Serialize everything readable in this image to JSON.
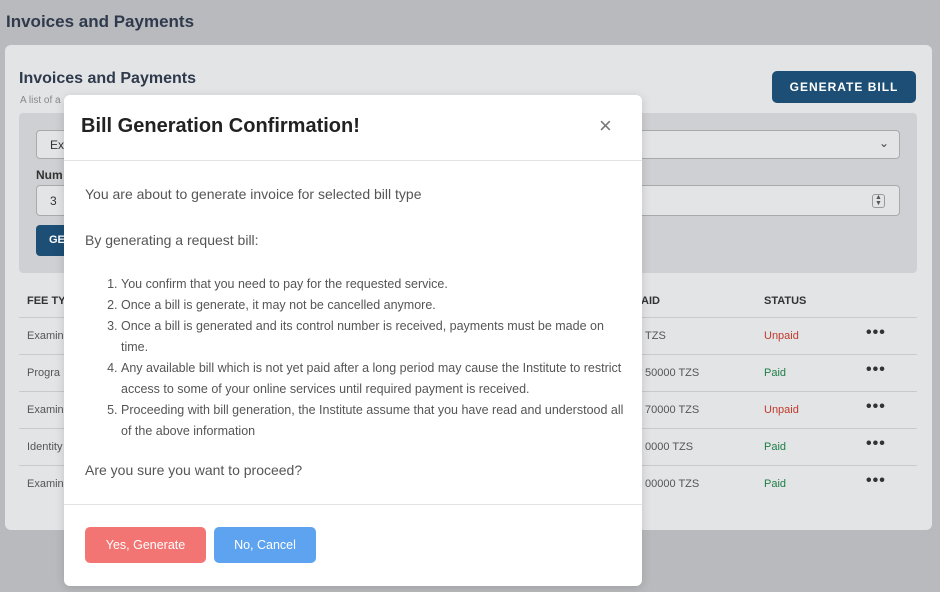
{
  "page": {
    "title": "Invoices and Payments"
  },
  "card": {
    "title": "Invoices and Payments",
    "subtitle": "A list of a",
    "generate_bill_label": "GENERATE BILL"
  },
  "filter": {
    "select_value": "Ex",
    "number_label": "Num",
    "number_value": "3",
    "button_label": "GE"
  },
  "table": {
    "headers": {
      "fee_type": "FEE TY",
      "amount_paid": "AID",
      "status": "STATUS"
    },
    "rows": [
      {
        "fee_type": "Examin",
        "amount": "TZS",
        "status": "Unpaid",
        "status_kind": "unpaid"
      },
      {
        "fee_type": "Progra",
        "amount": "50000 TZS",
        "status": "Paid",
        "status_kind": "paid"
      },
      {
        "fee_type": "Examin",
        "amount": "70000 TZS",
        "status": "Unpaid",
        "status_kind": "unpaid"
      },
      {
        "fee_type": "Identity",
        "amount": "0000 TZS",
        "status": "Paid",
        "status_kind": "paid"
      },
      {
        "fee_type": "Examin",
        "amount": "00000 TZS",
        "status": "Paid",
        "status_kind": "paid"
      }
    ],
    "more_glyph": "•••"
  },
  "modal": {
    "title": "Bill Generation Confirmation!",
    "close_glyph": "×",
    "intro": "You are about to generate invoice for selected bill type",
    "lead": "By generating a request bill:",
    "terms": [
      "You confirm that you need to pay for the requested service.",
      "Once a bill is generate, it may not be cancelled anymore.",
      "Once a bill is generated and its control number is received, payments must be made on time.",
      "Any available bill which is not yet paid after a long period may cause the Institute to restrict access to some of your online services until required payment is received.",
      "Proceeding with bill generation, the Institute assume that you have read and understood all of the above information"
    ],
    "question": "Are you sure you want to proceed?",
    "yes_label": "Yes, Generate",
    "no_label": "No, Cancel"
  },
  "colors": {
    "primary": "#1d4e75",
    "danger_button": "#f27573",
    "cancel_button": "#5ea3ef",
    "unpaid": "#c0392b",
    "paid": "#1e7e46"
  }
}
